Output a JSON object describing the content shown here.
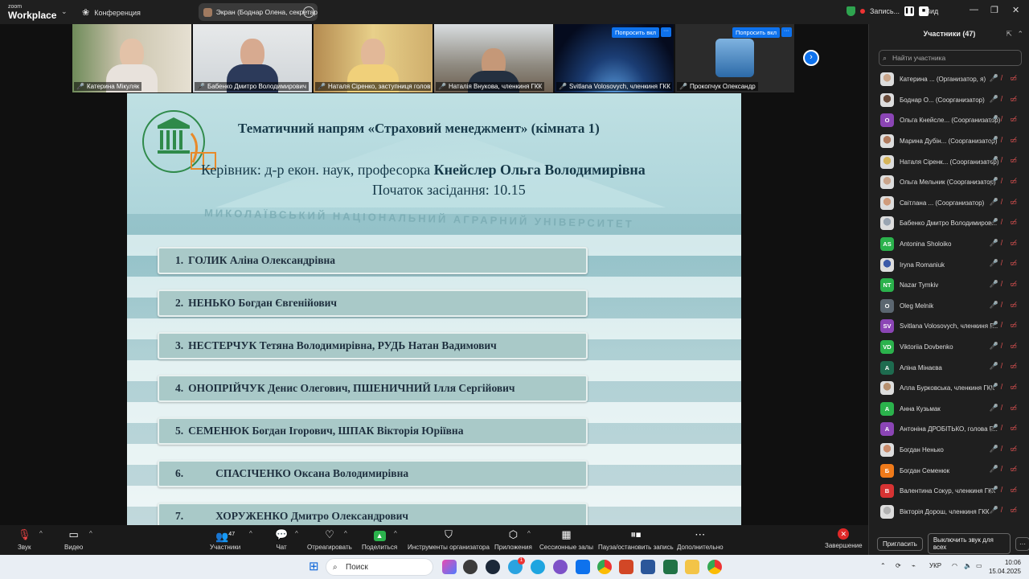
{
  "titlebar": {
    "logo_top": "zoom",
    "logo_bottom": "Workplace",
    "conference_label": "Конференция",
    "screen_share_label": "Экран (Боднар Олена, секретар",
    "recording_label": "Запись...",
    "view_label": "Вид"
  },
  "thumbnails": [
    {
      "name": "Катерина Мікуляк",
      "active": false
    },
    {
      "name": "Бабенко Дмитро Володимирович",
      "active": true
    },
    {
      "name": "Наталя Сіренко, заступниця голови...",
      "active": false
    },
    {
      "name": "Наталія Внукова, членкиня ГКК",
      "active": false
    },
    {
      "name": "Svitlana Volosovych, членкиня ГКК",
      "active": false,
      "ask_label": "Попросить вкл"
    },
    {
      "name": "Прокопчук Олександр",
      "active": false,
      "ask_label": "Попросить вкл"
    }
  ],
  "slide": {
    "title": "Тематичний напрям «Страховий менеджмент» (кімната 1)",
    "lead_prefix": "Керівник: д-р екон. наук, професорка ",
    "lead_name": "Кнейслер Ольга Володимирівна",
    "start": "Початок засідання: 10.15",
    "university_watermark": "МИКОЛАЇВСЬКИЙ НАЦІОНАЛЬНИЙ АГРАРНИЙ УНІВЕРСИТЕТ",
    "emblem_text": "НАЦІОНАЛЬНИЙ АГРАРНИЙ УНІВЕРСИТЕТ",
    "rows": [
      {
        "num": "1.",
        "text": "ГОЛИК Аліна Олександрівна",
        "wide_gap": false
      },
      {
        "num": "2.",
        "text": "НЕНЬКО Богдан Євгенійович",
        "wide_gap": false
      },
      {
        "num": "3.",
        "text": "НЕСТЕРЧУК Тетяна Володимирівна, РУДЬ Натан Вадимович",
        "wide_gap": false
      },
      {
        "num": "4.",
        "text": "ОНОПРІЙЧУК Денис Олегович, ПШЕНИЧНИЙ Ілля Сергійович",
        "wide_gap": false
      },
      {
        "num": "5.",
        "text": "СЕМЕНЮК Богдан Ігорович, ШПАК Вікторія Юріївна",
        "wide_gap": false
      },
      {
        "num": "6.",
        "text": "СПАСІЧЕНКО Оксана Володимирівна",
        "wide_gap": true
      },
      {
        "num": "7.",
        "text": "ХОРУЖЕНКО Дмитро Олександрович",
        "wide_gap": true
      }
    ]
  },
  "participants": {
    "title": "Участники (47)",
    "search_placeholder": "Найти участника",
    "invite_label": "Пригласить",
    "mute_all_label": "Выключить звук для всех",
    "list": [
      {
        "name": "Катерина ... (Организатор, я)",
        "avatar": "",
        "color": "#c9a58a",
        "photo": true
      },
      {
        "name": "Боднар О... (Соорганизатор)",
        "avatar": "",
        "color": "#6b4d3c",
        "photo": true
      },
      {
        "name": "Ольга Кнейсле... (Соорганизатор)",
        "avatar": "О",
        "color": "#8b45b5",
        "photo": false
      },
      {
        "name": "Марина Дубін... (Соорганизатор)",
        "avatar": "",
        "color": "#b07b5e",
        "photo": true
      },
      {
        "name": "Наталя Сіренк... (Соорганизатор)",
        "avatar": "",
        "color": "#d6b55a",
        "photo": true
      },
      {
        "name": "Ольга Мельник (Соорганизатор)",
        "avatar": "",
        "color": "#caa58c",
        "photo": true
      },
      {
        "name": "Світлана ... (Соорганизатор)",
        "avatar": "",
        "color": "#d09c7c",
        "photo": true
      },
      {
        "name": "Бабенко Дмитро Володимиров...",
        "avatar": "",
        "color": "#9aa5b2",
        "photo": true
      },
      {
        "name": "Antonina Sholoiko",
        "avatar": "AS",
        "color": "#2bb24c",
        "photo": false
      },
      {
        "name": "Iryna Romaniuk",
        "avatar": "",
        "color": "#3b5aa8",
        "photo": true
      },
      {
        "name": "Nazar Tymkiv",
        "avatar": "NT",
        "color": "#2bb24c",
        "photo": false
      },
      {
        "name": "Oleg Melnik",
        "avatar": "O",
        "color": "#5b6670",
        "photo": false
      },
      {
        "name": "Svitlana Volosovych, членкиня Г...",
        "avatar": "SV",
        "color": "#8b45b5",
        "photo": false
      },
      {
        "name": "Viktoriia Dovbenko",
        "avatar": "VD",
        "color": "#2bb24c",
        "photo": false
      },
      {
        "name": "Аліна Мінаєва",
        "avatar": "А",
        "color": "#1e6b4f",
        "photo": false
      },
      {
        "name": "Алла Бурковська, членкиня ГКК",
        "avatar": "",
        "color": "#b68f6e",
        "photo": true
      },
      {
        "name": "Анна Кузьмак",
        "avatar": "А",
        "color": "#2bb24c",
        "photo": false
      },
      {
        "name": "Антоніна ДРОБІТЬКО, голова Г...",
        "avatar": "А",
        "color": "#8b45b5",
        "photo": false
      },
      {
        "name": "Богдан Ненько",
        "avatar": "",
        "color": "#c98b6b",
        "photo": true
      },
      {
        "name": "Богдан Семенюк",
        "avatar": "Б",
        "color": "#ef7a1a",
        "photo": false
      },
      {
        "name": "Валентина Сокур, членкиня ГКК",
        "avatar": "В",
        "color": "#d63333",
        "photo": false
      },
      {
        "name": "Вікторія Дорош, членкиня ГКК",
        "avatar": "",
        "color": "#b2b2b2",
        "photo": true
      }
    ]
  },
  "toolbar": {
    "audio": "Звук",
    "video": "Видео",
    "participants": "Участники",
    "participants_count": "47",
    "chat": "Чат",
    "react": "Отреагировать",
    "share": "Поделиться",
    "host_tools": "Инструменты организатора",
    "apps": "Приложения",
    "breakout": "Сессионные залы",
    "pause_rec": "Пауза/остановить запись",
    "more": "Дополнительно",
    "end": "Завершение"
  },
  "taskbar": {
    "search": "Поиск",
    "lang": "УКР",
    "time": "10:06",
    "date": "15.04.2025",
    "badge": "1"
  },
  "colors": {
    "zoom_blue": "#0e72ed",
    "active_speaker": "#3cc36a",
    "end_red": "#e02828",
    "slide_row": "#a9c9c8"
  }
}
